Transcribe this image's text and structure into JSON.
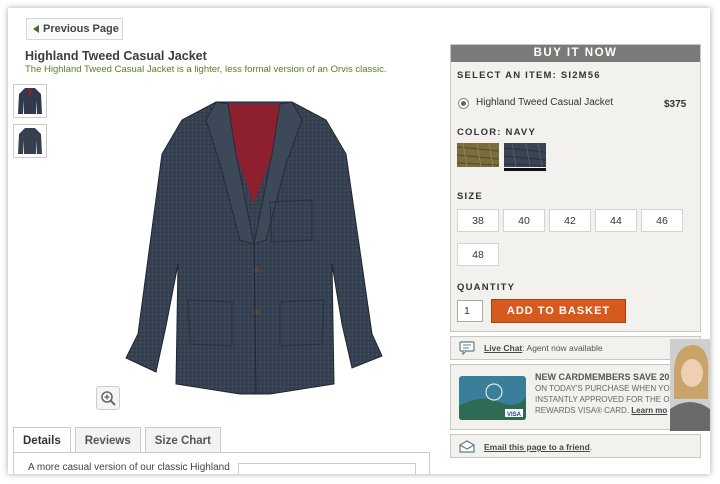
{
  "nav": {
    "previous_page": "Previous Page"
  },
  "product": {
    "title": "Highland Tweed Casual Jacket",
    "subtitle": "The Highland Tweed Casual Jacket is a lighter, less formal version of an Orvis classic."
  },
  "tabs": [
    {
      "label": "Details",
      "active": true
    },
    {
      "label": "Reviews",
      "active": false
    },
    {
      "label": "Size Chart",
      "active": false
    }
  ],
  "details_text": "A more casual version of our classic Highland",
  "buy": {
    "header": "BUY IT NOW",
    "select_label": "SELECT AN ITEM: SI2M56",
    "item_name": "Highland Tweed Casual Jacket",
    "item_price": "$375",
    "color_label": "COLOR: NAVY",
    "colors": [
      {
        "name": "olive-tweed",
        "hex": "#7a6d3c"
      },
      {
        "name": "navy",
        "hex": "#3a4452"
      }
    ],
    "size_label": "SIZE",
    "sizes": [
      "38",
      "40",
      "42",
      "44",
      "46",
      "48"
    ],
    "quantity_label": "QUANTITY",
    "quantity": "1",
    "add_label": "ADD TO BASKET"
  },
  "chat": {
    "link": "Live Chat",
    "status": ": Agent now available"
  },
  "promo": {
    "line1": "NEW CARDMEMBERS SAVE 20",
    "line2": "ON TODAY'S PURCHASE WHEN YOU",
    "line3": "INSTANTLY APPROVED FOR THE OR",
    "line4": "REWARDS VISA® CARD.",
    "learn": "Learn mo",
    "card_brand": "VISA"
  },
  "email": {
    "link": "Email this page to a friend",
    "suffix": "."
  },
  "colors": {
    "accent_orange": "#d65a1e",
    "header_gray": "#7a7a78",
    "subtitle_green": "#5b7d2a"
  }
}
